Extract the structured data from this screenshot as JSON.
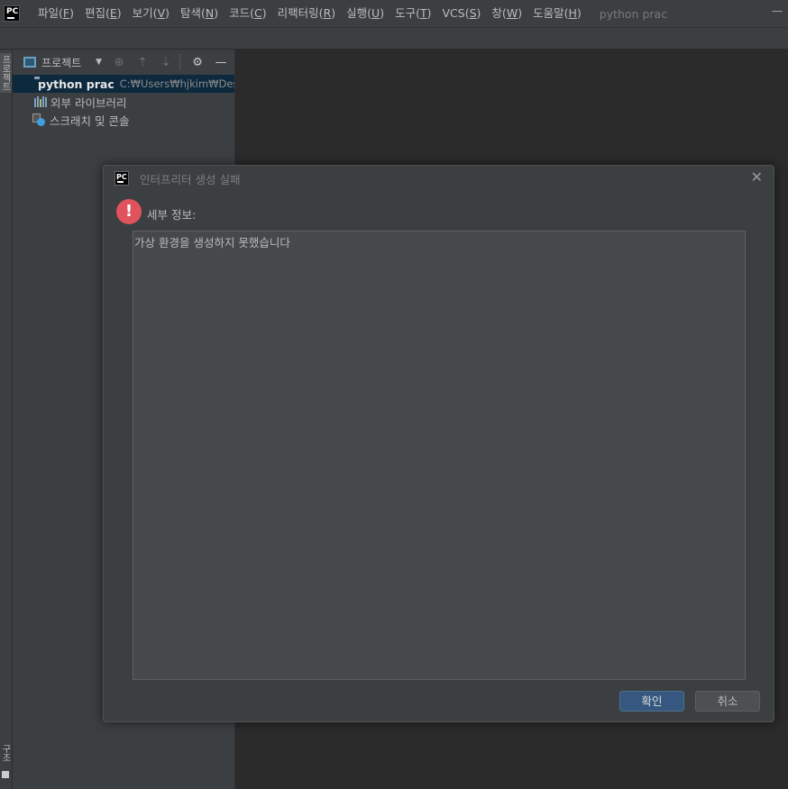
{
  "menubar": {
    "items": [
      {
        "text": "파일(",
        "key": "F",
        "end": ")"
      },
      {
        "text": "편집(",
        "key": "E",
        "end": ")"
      },
      {
        "text": "보기(",
        "key": "V",
        "end": ")"
      },
      {
        "text": "탐색(",
        "key": "N",
        "end": ")"
      },
      {
        "text": "코드(",
        "key": "C",
        "end": ")"
      },
      {
        "text": "리팩터링(",
        "key": "R",
        "end": ")"
      },
      {
        "text": "실행(",
        "key": "U",
        "end": ")"
      },
      {
        "text": "도구(",
        "key": "T",
        "end": ")"
      },
      {
        "text": "VCS(",
        "key": "S",
        "end": ")"
      },
      {
        "text": "창(",
        "key": "W",
        "end": ")"
      },
      {
        "text": "도움말(",
        "key": "H",
        "end": ")"
      }
    ],
    "window_title": "python prac",
    "logo_text": "PC"
  },
  "left_strip": {
    "top_label": "프로젝트",
    "bottom_label": "구조"
  },
  "project_panel": {
    "title": "프로젝트",
    "tree": {
      "root_name": "python prac",
      "root_path": "C:₩Users₩hjkim₩Deskto",
      "external_libraries": "외부 라이브러리",
      "scratches": "스크래치 및 콘솔"
    }
  },
  "dialog": {
    "logo_text": "PC",
    "title": "인터프리터 생성 실패",
    "error_mark": "!",
    "details_label": "세부 정보:",
    "details_text": "가상 환경을 생성하지 못했습니다",
    "ok_label": "확인",
    "cancel_label": "취소",
    "close_glyph": "✕"
  }
}
